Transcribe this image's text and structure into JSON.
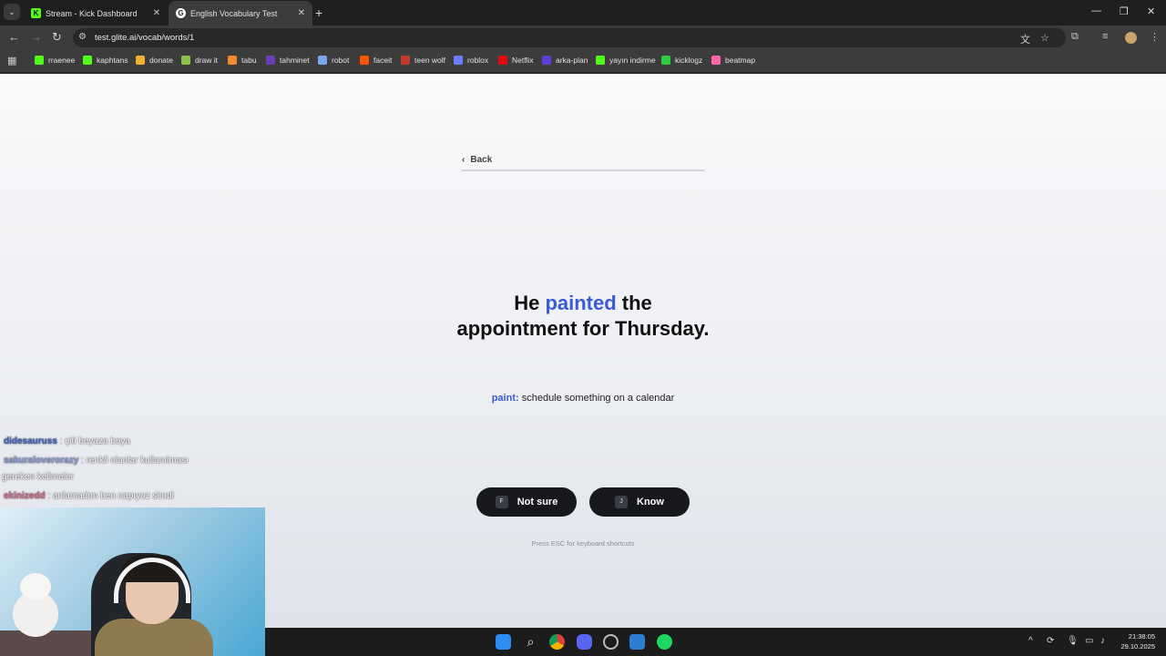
{
  "browser": {
    "tabs": [
      {
        "title": "Stream - Kick Dashboard",
        "favicon": "kick-icon",
        "active": false
      },
      {
        "title": "English Vocabulary Test",
        "favicon": "glite-icon",
        "active": true
      }
    ],
    "url": "test.glite.ai/vocab/words/1",
    "bookmarks": [
      {
        "label": "rraenee",
        "icon": "kick-icon",
        "color": "#53fc18"
      },
      {
        "label": "kaphtans",
        "icon": "kick-icon",
        "color": "#53fc18"
      },
      {
        "label": "donate",
        "icon": "donate-icon",
        "color": "#f0b030"
      },
      {
        "label": "draw it",
        "icon": "draw-icon",
        "color": "#8bc34a"
      },
      {
        "label": "tabu",
        "icon": "tabu-icon",
        "color": "#f28b30"
      },
      {
        "label": "tahminet",
        "icon": "tahminet-icon",
        "color": "#6a3fb5"
      },
      {
        "label": "robot",
        "icon": "robot-icon",
        "color": "#7aa7f0"
      },
      {
        "label": "faceit",
        "icon": "faceit-icon",
        "color": "#ff5500"
      },
      {
        "label": "teen wolf",
        "icon": "teenwolf-icon",
        "color": "#c0392b"
      },
      {
        "label": "roblox",
        "icon": "roblox-icon",
        "color": "#6d7cff"
      },
      {
        "label": "Netflix",
        "icon": "netflix-icon",
        "color": "#e50914"
      },
      {
        "label": "arka-plan",
        "icon": "arkaplan-icon",
        "color": "#5b3fd6"
      },
      {
        "label": "yayın indirme",
        "icon": "download-icon",
        "color": "#53fc18"
      },
      {
        "label": "kicklogz",
        "icon": "kicklogz-icon",
        "color": "#2ecc40"
      },
      {
        "label": "beatmap",
        "icon": "osu-icon",
        "color": "#ff66aa"
      }
    ]
  },
  "page": {
    "back_label": "Back",
    "progress_fraction": 1.0,
    "sentence": {
      "before": "He ",
      "highlight": "painted",
      "after": " the appointment for Thursday."
    },
    "definition": {
      "term": "paint:",
      "meaning": " schedule something on a calendar"
    },
    "buttons": {
      "not_sure": {
        "key": "F",
        "label": "Not sure"
      },
      "know": {
        "key": "J",
        "label": "Know"
      }
    },
    "hint": "Press ESC for keyboard shortcuts",
    "accent_color": "#3b5bd3"
  },
  "stream_chat": [
    {
      "user": "didesauruss",
      "user_color": "#3f66c8",
      "message": " : çiti beyaza boya"
    },
    {
      "user": "sakuraloverorazy",
      "user_color": "#8aa0d8",
      "message": " : renkli olanlar kullanılması"
    },
    {
      "user": "",
      "user_color": "#ffffff",
      "message": "gereken kelimeler"
    },
    {
      "user": "ekinizedd",
      "user_color": "#d06a8a",
      "message": " : anlamadım ben napıyoz simdi"
    }
  ],
  "taskbar": {
    "time": "21:38:05",
    "date": "29.10.2025",
    "apps": [
      "windows-start-icon",
      "search-icon",
      "chrome-icon",
      "discord-icon",
      "settings-icon",
      "editor-icon",
      "spotify-icon"
    ]
  }
}
